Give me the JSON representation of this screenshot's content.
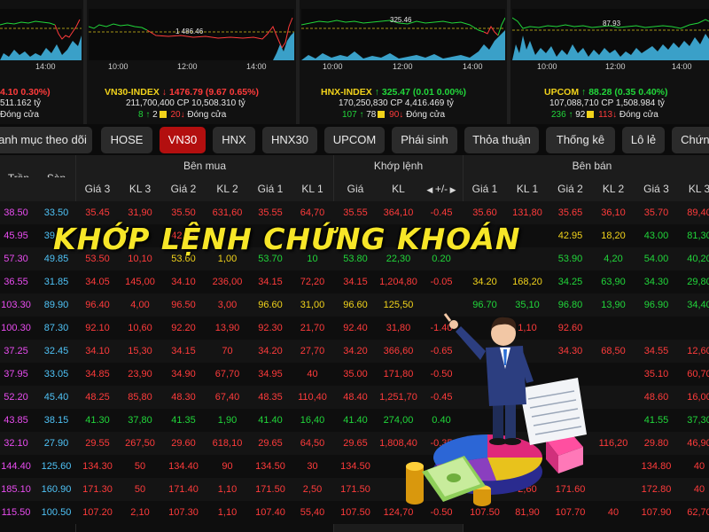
{
  "indices": [
    {
      "chart_label": "",
      "times": [
        "14:00"
      ],
      "line1": {
        "name": "",
        "arrow": "",
        "value": "",
        "change": "4.10  0.30%)",
        "color": "#ff3b3b"
      },
      "line2": {
        "text": "511.162 tỷ"
      },
      "line3": {
        "up": "",
        "ref": "",
        "down": "",
        "status": "Đóng cửa"
      }
    },
    {
      "chart_label": "1 486.46",
      "times": [
        "10:00",
        "12:00",
        "14:00"
      ],
      "line1": {
        "name": "VN30-INDEX",
        "arrow": "↓",
        "value": "1476.79",
        "change": "(9.67  0.65%)",
        "color": "#ff3b3b"
      },
      "line2": {
        "text": "211,700,400  CP  10,508.310  tỷ"
      },
      "line3": {
        "up": "8",
        "ref": "2",
        "down": "20",
        "status": "Đóng cửa"
      }
    },
    {
      "chart_label": "325.46",
      "times": [
        "10:00",
        "12:00",
        "14:00"
      ],
      "line1": {
        "name": "HNX-INDEX",
        "arrow": "↑",
        "value": "325.47",
        "change": "(0.01  0.00%)",
        "color": "#21d63a"
      },
      "line2": {
        "text": "170,250,830  CP  4,416.469  tỷ"
      },
      "line3": {
        "up": "107",
        "ref": "78",
        "down": "90",
        "status": "Đóng cửa"
      }
    },
    {
      "chart_label": "87.93",
      "times": [
        "10:00",
        "12:00",
        "14:00"
      ],
      "line1": {
        "name": "UPCOM",
        "arrow": "↑",
        "value": "88.28",
        "change": "(0.35  0.40%)",
        "color": "#21d63a"
      },
      "line2": {
        "text": "107,088,710  CP  1,508.984  tỷ"
      },
      "line3": {
        "up": "236",
        "ref": "92",
        "down": "113",
        "status": "Đóng cửa"
      }
    }
  ],
  "tabs": [
    "anh mục theo dõi",
    "HOSE",
    "VN30",
    "HNX",
    "HNX30",
    "UPCOM",
    "Phái sinh",
    "Thỏa thuận",
    "Thống kê",
    "Lô lẻ",
    "Chứng"
  ],
  "active_tab": "VN30",
  "table": {
    "col_tran": "Trần",
    "col_san": "Sàn",
    "group_buy": "Bên mua",
    "group_match": "Khớp lệnh",
    "group_sell": "Bên bán",
    "buy_headers": [
      "Giá 3",
      "KL 3",
      "Giá 2",
      "KL 2",
      "Giá 1",
      "KL 1"
    ],
    "match_headers": [
      "Giá",
      "KL",
      "+/-"
    ],
    "sell_headers": [
      "Giá 1",
      "KL 1",
      "Giá 2",
      "KL 2",
      "Giá 3",
      "KL 3"
    ],
    "rows": [
      {
        "tran": "38.50",
        "san": "33.50",
        "b": [
          "35.45",
          "31,90",
          "35.50",
          "631,60",
          "35.55",
          "64,70"
        ],
        "bc": [
          "r",
          "r",
          "r",
          "r",
          "r",
          "r"
        ],
        "m": [
          "35.55",
          "364,10",
          "-0.45"
        ],
        "mc": [
          "r",
          "r",
          "r"
        ],
        "s": [
          "35.60",
          "131,80",
          "35.65",
          "36,10",
          "35.70",
          "89,40"
        ],
        "sc": [
          "r",
          "r",
          "r",
          "r",
          "r",
          "r"
        ]
      },
      {
        "tran": "45.95",
        "san": "39.95",
        "b": [
          "",
          "",
          "42.75",
          "",
          "",
          ""
        ],
        "bc": [
          "r",
          "r",
          "r",
          "r",
          "r",
          "r"
        ],
        "m": [
          "",
          "",
          ""
        ],
        "mc": [
          "r",
          "r",
          "r"
        ],
        "s": [
          "",
          "",
          "42.95",
          "18,20",
          "43.00",
          "81,30"
        ],
        "sc": [
          "g",
          "g",
          "y",
          "y",
          "g",
          "g"
        ]
      },
      {
        "tran": "57.30",
        "san": "49.85",
        "b": [
          "53.50",
          "10,10",
          "53.60",
          "1,00",
          "53.70",
          "10"
        ],
        "bc": [
          "r",
          "r",
          "y",
          "y",
          "g",
          "g"
        ],
        "m": [
          "53.80",
          "22,30",
          "0.20"
        ],
        "mc": [
          "g",
          "g",
          "g"
        ],
        "s": [
          "",
          "",
          "53.90",
          "4,20",
          "54.00",
          "40,20"
        ],
        "sc": [
          "g",
          "g",
          "g",
          "g",
          "g",
          "g"
        ]
      },
      {
        "tran": "36.55",
        "san": "31.85",
        "b": [
          "34.05",
          "145,00",
          "34.10",
          "236,00",
          "34.15",
          "72,20"
        ],
        "bc": [
          "r",
          "r",
          "r",
          "r",
          "r",
          "r"
        ],
        "m": [
          "34.15",
          "1,204,80",
          "-0.05"
        ],
        "mc": [
          "r",
          "r",
          "r"
        ],
        "s": [
          "34.20",
          "168,20",
          "34.25",
          "63,90",
          "34.30",
          "29,80"
        ],
        "sc": [
          "y",
          "y",
          "g",
          "g",
          "g",
          "g"
        ]
      },
      {
        "tran": "103.30",
        "san": "89.90",
        "b": [
          "96.40",
          "4,00",
          "96.50",
          "3,00",
          "96.60",
          "31,00"
        ],
        "bc": [
          "r",
          "r",
          "r",
          "r",
          "y",
          "y"
        ],
        "m": [
          "96.60",
          "125,50",
          ""
        ],
        "mc": [
          "y",
          "y",
          "y"
        ],
        "s": [
          "96.70",
          "35,10",
          "96.80",
          "13,90",
          "96.90",
          "34,40"
        ],
        "sc": [
          "g",
          "g",
          "g",
          "g",
          "g",
          "g"
        ]
      },
      {
        "tran": "100.30",
        "san": "87.30",
        "b": [
          "92.10",
          "10,60",
          "92.20",
          "13,90",
          "92.30",
          "21,70"
        ],
        "bc": [
          "r",
          "r",
          "r",
          "r",
          "r",
          "r"
        ],
        "m": [
          "92.40",
          "31,80",
          "-1.40"
        ],
        "mc": [
          "r",
          "r",
          "r"
        ],
        "s": [
          "",
          "1,10",
          "92.60",
          "",
          "",
          ""
        ],
        "sc": [
          "r",
          "r",
          "r",
          "r",
          "r",
          "r"
        ]
      },
      {
        "tran": "37.25",
        "san": "32.45",
        "b": [
          "34.10",
          "15,30",
          "34.15",
          "70",
          "34.20",
          "27,70"
        ],
        "bc": [
          "r",
          "r",
          "r",
          "r",
          "r",
          "r"
        ],
        "m": [
          "34.20",
          "366,60",
          "-0.65"
        ],
        "mc": [
          "r",
          "r",
          "r"
        ],
        "s": [
          "",
          "",
          "34.30",
          "68,50",
          "34.55",
          "12,60"
        ],
        "sc": [
          "r",
          "r",
          "r",
          "r",
          "r",
          "r"
        ]
      },
      {
        "tran": "37.95",
        "san": "33.05",
        "b": [
          "34.85",
          "23,90",
          "34.90",
          "67,70",
          "34.95",
          "40"
        ],
        "bc": [
          "r",
          "r",
          "r",
          "r",
          "r",
          "r"
        ],
        "m": [
          "35.00",
          "171,80",
          "-0.50"
        ],
        "mc": [
          "r",
          "r",
          "r"
        ],
        "s": [
          "",
          "",
          "",
          "",
          "35.10",
          "60,70"
        ],
        "sc": [
          "r",
          "r",
          "r",
          "r",
          "r",
          "r"
        ]
      },
      {
        "tran": "52.20",
        "san": "45.40",
        "b": [
          "48.25",
          "85,80",
          "48.30",
          "67,40",
          "48.35",
          "110,40"
        ],
        "bc": [
          "r",
          "r",
          "r",
          "r",
          "r",
          "r"
        ],
        "m": [
          "48.40",
          "1,251,70",
          "-0.45"
        ],
        "mc": [
          "r",
          "r",
          "r"
        ],
        "s": [
          "",
          "",
          "",
          "",
          "48.60",
          "16,00"
        ],
        "sc": [
          "r",
          "r",
          "r",
          "r",
          "r",
          "r"
        ]
      },
      {
        "tran": "43.85",
        "san": "38.15",
        "b": [
          "41.30",
          "37,80",
          "41.35",
          "1,90",
          "41.40",
          "16,40"
        ],
        "bc": [
          "g",
          "g",
          "g",
          "g",
          "g",
          "g"
        ],
        "m": [
          "41.40",
          "274,00",
          "0.40"
        ],
        "mc": [
          "g",
          "g",
          "g"
        ],
        "s": [
          "",
          "",
          "",
          "",
          "41.55",
          "37,30"
        ],
        "sc": [
          "g",
          "g",
          "g",
          "g",
          "g",
          "g"
        ]
      },
      {
        "tran": "32.10",
        "san": "27.90",
        "b": [
          "29.55",
          "267,50",
          "29.60",
          "618,10",
          "29.65",
          "64,50"
        ],
        "bc": [
          "r",
          "r",
          "r",
          "r",
          "r",
          "r"
        ],
        "m": [
          "29.65",
          "1,808,40",
          "-0.35"
        ],
        "mc": [
          "r",
          "r",
          "r"
        ],
        "s": [
          "",
          "",
          "",
          "116,20",
          "29.80",
          "46,90"
        ],
        "sc": [
          "r",
          "r",
          "r",
          "r",
          "r",
          "r"
        ]
      },
      {
        "tran": "144.40",
        "san": "125.60",
        "b": [
          "134.30",
          "50",
          "134.40",
          "90",
          "134.50",
          "30"
        ],
        "bc": [
          "r",
          "r",
          "r",
          "r",
          "r",
          "r"
        ],
        "m": [
          "134.50",
          "",
          ""
        ],
        "mc": [
          "r",
          "r",
          "r"
        ],
        "s": [
          "",
          "",
          "",
          "",
          "134.80",
          "40"
        ],
        "sc": [
          "r",
          "r",
          "r",
          "r",
          "r",
          "r"
        ]
      },
      {
        "tran": "185.10",
        "san": "160.90",
        "b": [
          "171.30",
          "50",
          "171.40",
          "1,10",
          "171.50",
          "2,50"
        ],
        "bc": [
          "r",
          "r",
          "r",
          "r",
          "r",
          "r"
        ],
        "m": [
          "171.50",
          "",
          ""
        ],
        "mc": [
          "r",
          "r",
          "r"
        ],
        "s": [
          "",
          "2,60",
          "171.60",
          "",
          "172.80",
          "40"
        ],
        "sc": [
          "r",
          "r",
          "r",
          "r",
          "r",
          "r"
        ]
      },
      {
        "tran": "115.50",
        "san": "100.50",
        "b": [
          "107.20",
          "2,10",
          "107.30",
          "1,10",
          "107.40",
          "55,40"
        ],
        "bc": [
          "r",
          "r",
          "r",
          "r",
          "r",
          "r"
        ],
        "m": [
          "107.50",
          "124,70",
          "-0.50"
        ],
        "mc": [
          "r",
          "r",
          "r"
        ],
        "s": [
          "107.50",
          "81,90",
          "107.70",
          "40",
          "107.90",
          "62,70"
        ],
        "sc": [
          "r",
          "r",
          "r",
          "r",
          "r",
          "r"
        ]
      }
    ]
  },
  "banner_text": "KHỚP LỆNH CHỨNG KHOÁN",
  "colors": {
    "up": "#21d63a",
    "down": "#ff3b3b",
    "ref": "#f2d31b",
    "ceiling": "#e94cf0",
    "floor": "#4fc3f7",
    "active_tab": "#b30f0f"
  }
}
